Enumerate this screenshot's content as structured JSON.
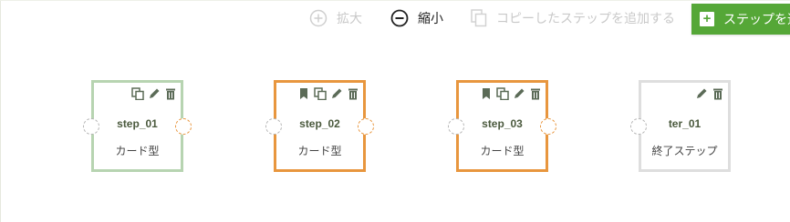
{
  "toolbar": {
    "zoom_in_label": "拡大",
    "zoom_out_label": "縮小",
    "copy_step_label": "コピーしたステップを追加する",
    "add_step_label": "ステップを追加"
  },
  "steps": [
    {
      "name": "step_01",
      "type": "カード型"
    },
    {
      "name": "step_02",
      "type": "カード型"
    },
    {
      "name": "step_03",
      "type": "カード型"
    },
    {
      "name": "ter_01",
      "type": "終了ステップ"
    }
  ],
  "colors": {
    "accent_green": "#55a737",
    "selected_orange": "#e8963e",
    "card_green": "#b7d4b1",
    "terminal_gray": "#dedede"
  }
}
